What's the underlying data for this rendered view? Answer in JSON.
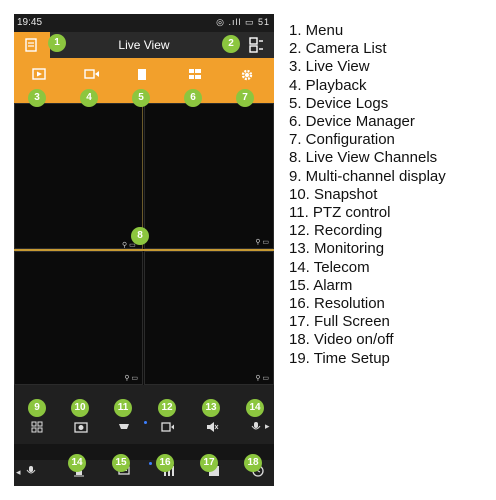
{
  "status_bar": {
    "time": "19:45",
    "indicators": "◎ .ıll ▭ 51"
  },
  "title_bar": {
    "title": "Live View"
  },
  "colors": {
    "accent": "#f2a02c",
    "badge": "#8cc63f",
    "background": "#151515"
  },
  "toolbar": {
    "items": [
      {
        "name": "live-view",
        "icon": "play-screen-icon"
      },
      {
        "name": "playback",
        "icon": "video-camera-icon"
      },
      {
        "name": "device-logs",
        "icon": "document-icon"
      },
      {
        "name": "device-manager",
        "icon": "list-icon"
      },
      {
        "name": "configuration",
        "icon": "gear-icon"
      }
    ]
  },
  "controls": {
    "icons": [
      "four-grid-icon",
      "snapshot-icon",
      "ptz-icon",
      "record-icon",
      "mute-icon",
      "mic-icon"
    ],
    "bottom_icons": [
      "mic-icon",
      "alarm-light-icon",
      "chat-icon",
      "signal-icon",
      "fullscreen-icon",
      "clock-icon"
    ]
  },
  "badges": [
    "1",
    "2",
    "3",
    "4",
    "5",
    "6",
    "7",
    "8",
    "9",
    "10",
    "11",
    "12",
    "13",
    "14",
    "15",
    "16",
    "17",
    "18"
  ],
  "legend": [
    "1. Menu",
    "2. Camera List",
    "3. Live View",
    "4. Playback",
    "5. Device Logs",
    "6. Device Manager",
    "7. Configuration",
    "8. Live View Channels",
    "9. Multi-channel display",
    "10. Snapshot",
    "11. PTZ control",
    "12. Recording",
    "13. Monitoring",
    "14. Telecom",
    "15. Alarm",
    "16. Resolution",
    "17. Full Screen",
    "18. Video on/off",
    "19. Time Setup"
  ]
}
